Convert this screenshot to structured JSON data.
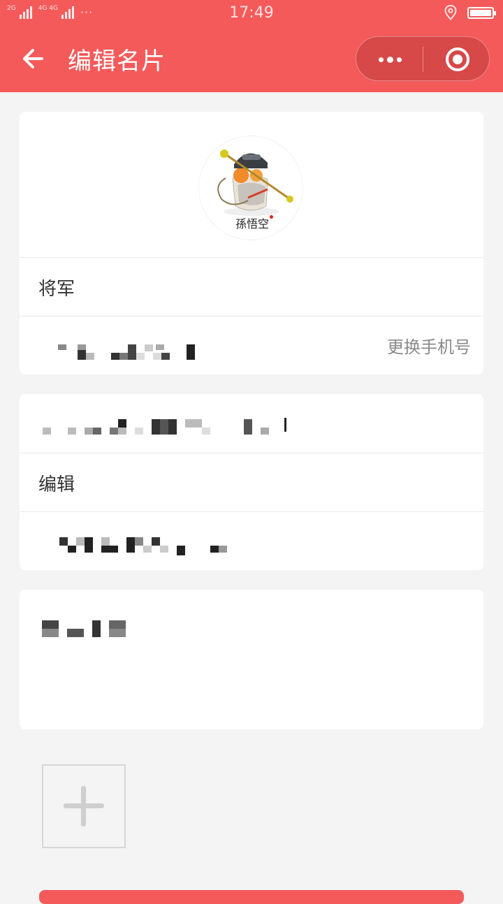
{
  "status_bar": {
    "network_left": "2G",
    "network_right": "4G 4G",
    "time": "17:49"
  },
  "nav": {
    "title": "编辑名片"
  },
  "profile": {
    "name": "将军",
    "phone_obscured": "",
    "change_phone_label": "更换手机号",
    "avatar_caption": "孫悟空"
  },
  "details": {
    "company_obscured": "",
    "title": "编辑",
    "address_obscured": ""
  },
  "intro": {
    "text_obscured": ""
  },
  "colors": {
    "accent": "#f45a5a",
    "background": "#f4f4f4"
  },
  "icons": [
    "back-arrow-icon",
    "more-dots-icon",
    "close-target-icon",
    "plus-icon",
    "location-icon",
    "battery-icon"
  ]
}
